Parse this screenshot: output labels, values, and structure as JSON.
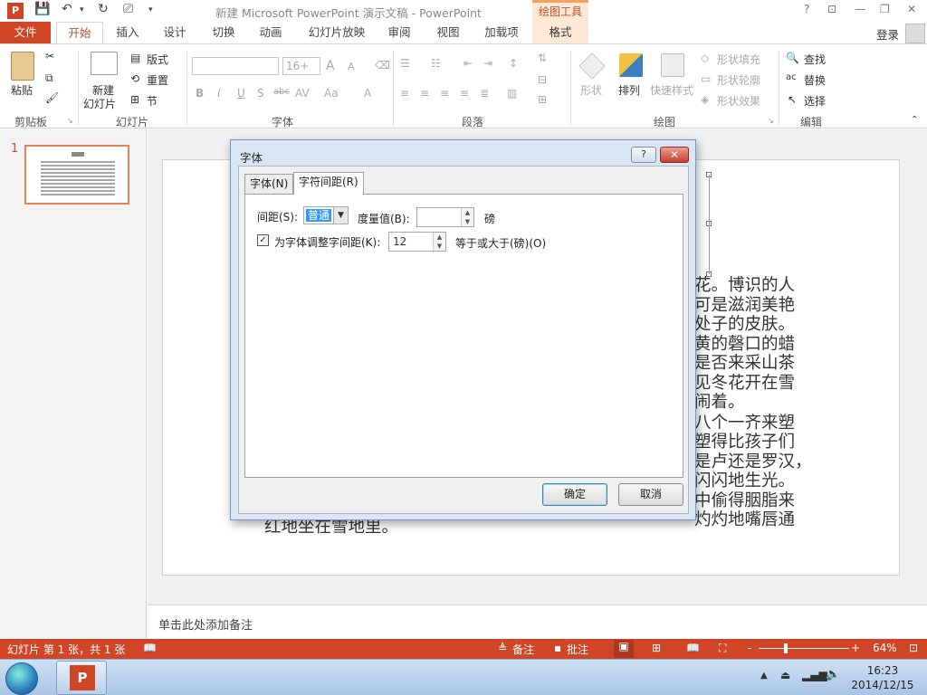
{
  "titlebar": {
    "doc_title": "新建 Microsoft PowerPoint 演示文稿 - PowerPoint",
    "context_tools": "绘图工具",
    "help": "?",
    "login": "登录"
  },
  "tabs": {
    "file": "文件",
    "home": "开始",
    "insert": "插入",
    "design": "设计",
    "transitions": "切换",
    "animations": "动画",
    "slideshow": "幻灯片放映",
    "review": "审阅",
    "view": "视图",
    "addins": "加载项",
    "format": "格式"
  },
  "ribbon": {
    "clipboard": {
      "paste": "粘贴",
      "label": "剪贴板"
    },
    "slides": {
      "new_slide_1": "新建",
      "new_slide_2": "幻灯片",
      "layout": "版式",
      "reset": "重置",
      "section": "节",
      "label": "幻灯片"
    },
    "font": {
      "size": "16+",
      "bold": "B",
      "italic": "I",
      "underline": "U",
      "shadow": "S",
      "strike": "abc",
      "spacing": "AV",
      "case": "Aa",
      "color": "A",
      "grow": "A",
      "shrink": "A",
      "label": "字体"
    },
    "paragraph": {
      "label": "段落"
    },
    "drawing": {
      "shapes": "形状",
      "arrange": "排列",
      "quick_styles": "快速样式",
      "fill": "形状填充",
      "outline": "形状轮廓",
      "effects": "形状效果",
      "label": "绘图"
    },
    "editing": {
      "find": "查找",
      "replace": "替换",
      "select": "选择",
      "label": "编辑"
    }
  },
  "thumbnail": {
    "number": "1"
  },
  "slide": {
    "right_lines": [
      "花。博识的人",
      "可是滋润美艳",
      "处子的皮肤。",
      "黄的磬口的蜡",
      "是否来采山茶",
      "见冬花开在雪",
      "闹着。",
      "八个一齐来塑",
      "塑得比孩子们",
      "是卢还是罗汉，",
      "闪闪地生光。",
      "中偷得胭脂来",
      "灼灼地嘴唇通"
    ],
    "bottom_line": "红地坐在雪地里。"
  },
  "notes": {
    "placeholder": "单击此处添加备注"
  },
  "statusbar": {
    "slide_info": "幻灯片 第 1 张，共 1 张",
    "notes": "备注",
    "comments": "批注",
    "zoom": "64%",
    "minus": "-",
    "plus": "+"
  },
  "taskbar": {
    "time": "16:23",
    "date": "2014/12/15"
  },
  "dialog": {
    "title": "字体",
    "help": "?",
    "close": "✕",
    "tabs": {
      "font": "字体(N)",
      "spacing": "字符间距(R)"
    },
    "spacing_label": "间距(S):",
    "spacing_value": "普通",
    "by_label": "度量值(B):",
    "by_value": "",
    "by_unit": "磅",
    "kerning_label": "为字体调整字间距(K):",
    "kerning_value": "12",
    "kerning_suffix": "等于或大于(磅)(O)",
    "ok": "确定",
    "cancel": "取消"
  },
  "colors": {
    "accent": "#D04525",
    "dialog_bg": "#D9E6F4"
  }
}
